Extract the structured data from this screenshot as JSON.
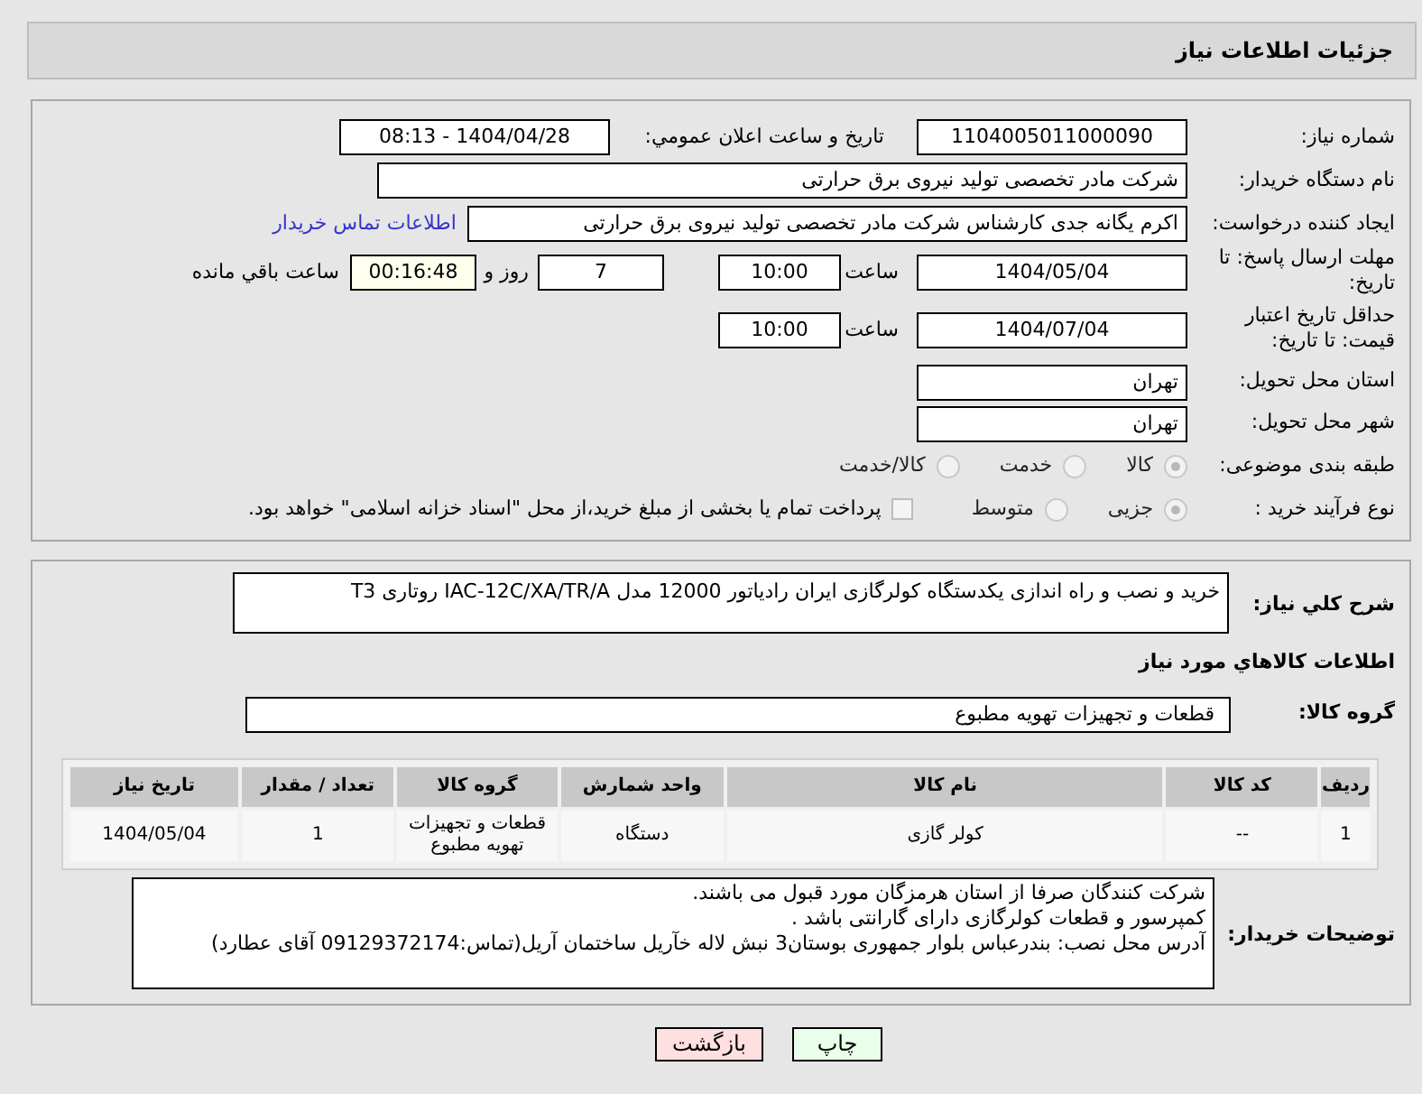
{
  "header": {
    "title": "جزئیات اطلاعات نیاز"
  },
  "need_number": {
    "label": "شماره نیاز:",
    "value": "1104005011000090"
  },
  "announce": {
    "label": "تاریخ و ساعت اعلان عمومي:",
    "value": "1404/04/28 - 08:13"
  },
  "buyer_org": {
    "label": "نام دستگاه خریدار:",
    "value": "شرکت مادر تخصصی تولید نیروی برق حرارتی"
  },
  "requester": {
    "label": "ایجاد کننده درخواست:",
    "value": "اکرم یگانه جدی کارشناس شرکت مادر تخصصی تولید نیروی برق حرارتی",
    "link": "اطلاعات تماس خریدار"
  },
  "deadline": {
    "label": "مهلت ارسال پاسخ: تا تاریخ:",
    "date": "1404/05/04",
    "time_label": "ساعت",
    "time": "10:00",
    "days": "7",
    "days_label": "روز و",
    "remaining": "00:16:48",
    "remaining_label": "ساعت باقي مانده"
  },
  "validity": {
    "label": "حداقل تاریخ اعتبار قیمت: تا تاریخ:",
    "date": "1404/07/04",
    "time_label": "ساعت",
    "time": "10:00"
  },
  "province": {
    "label": "استان محل تحویل:",
    "value": "تهران"
  },
  "city": {
    "label": "شهر محل تحویل:",
    "value": "تهران"
  },
  "category": {
    "label": "طبقه بندی موضوعی:",
    "options": [
      {
        "label": "کالا",
        "selected": true
      },
      {
        "label": "خدمت",
        "selected": false
      },
      {
        "label": "کالا/خدمت",
        "selected": false
      }
    ]
  },
  "process": {
    "label": "نوع فرآیند خرید :",
    "options": [
      {
        "label": "جزیی",
        "selected": true
      },
      {
        "label": "متوسط",
        "selected": false
      }
    ],
    "payment": {
      "checked": false,
      "text": "پرداخت تمام یا بخشی از مبلغ خرید،از محل \"اسناد خزانه اسلامی\" خواهد بود."
    }
  },
  "description": {
    "label": "شرح کلي نياز:",
    "value": "خرید و نصب و راه اندازی یکدستگاه کولرگازی ایران رادیاتور 12000 مدل IAC-12C/XA/TR/A  روتاری T3"
  },
  "goods_heading": "اطلاعات کالاهاي مورد نياز",
  "goods_group": {
    "label": "گروه کالا:",
    "value": "قطعات و تجهیزات تهویه مطبوع"
  },
  "table": {
    "columns": [
      "ردیف",
      "کد کالا",
      "نام کالا",
      "واحد شمارش",
      "گروه کالا",
      "تعداد / مقدار",
      "تاریخ نیاز"
    ],
    "rows": [
      [
        "1",
        "--",
        "کولر گازی",
        "دستگاه",
        "قطعات و تجهیزات تهویه مطبوع",
        "1",
        "1404/05/04"
      ]
    ]
  },
  "notes": {
    "label": "توضیحات خریدار:",
    "lines": [
      "شرکت کنندگان صرفا از استان هرمزگان مورد قبول می باشند.",
      "کمپرسور و قطعات کولرگازی دارای گارانتی باشد .",
      "آدرس محل نصب: بندرعباس بلوار جمهوری بوستان3 نبش لاله خآریل ساختمان آریل(تماس:09129372174 آقای عطارد)"
    ]
  },
  "buttons": [
    {
      "label": "چاپ",
      "kind": "print"
    },
    {
      "label": "بازگشت",
      "kind": "back"
    }
  ]
}
